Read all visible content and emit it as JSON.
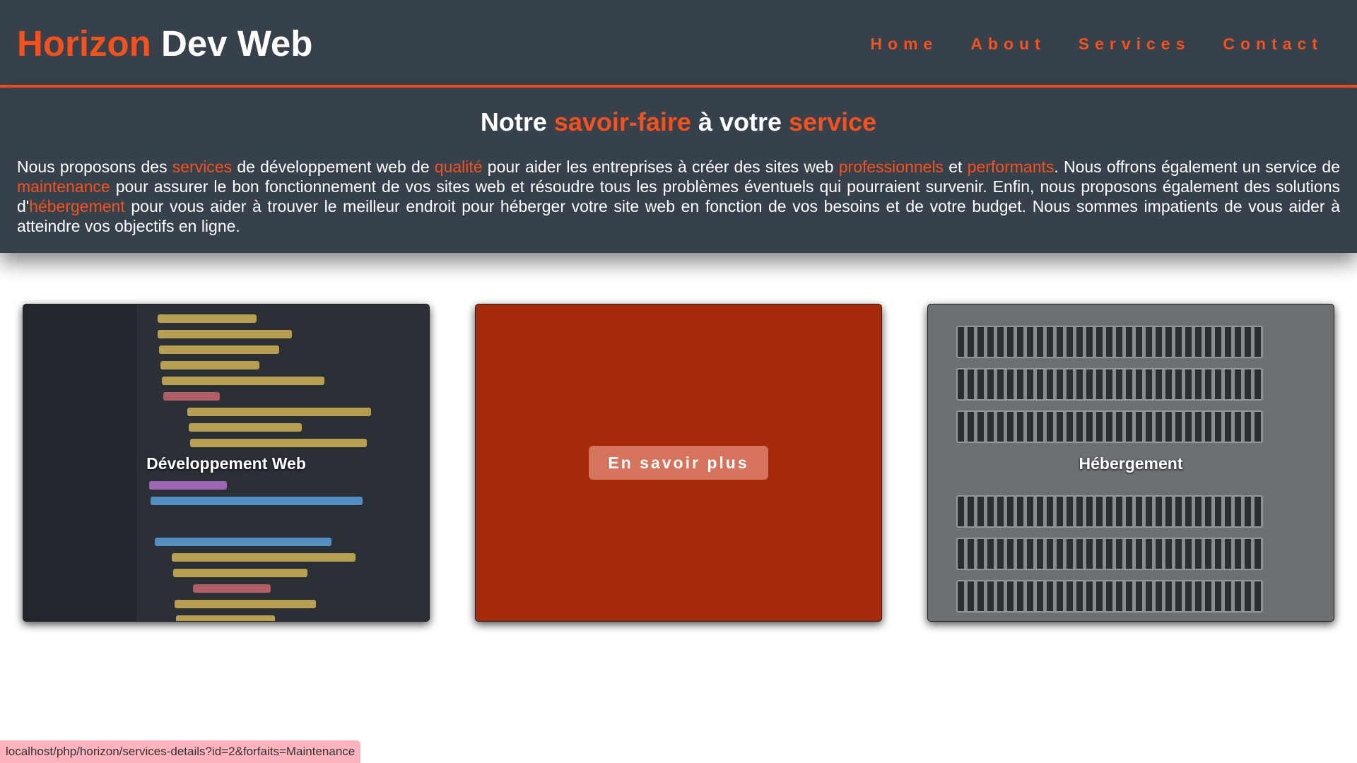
{
  "header": {
    "logo_part1": "Horizon",
    "logo_part2": " Dev Web",
    "nav": [
      "Home",
      "About",
      "Services",
      "Contact"
    ]
  },
  "intro": {
    "title_parts": [
      "Notre ",
      "savoir-faire",
      " à votre ",
      "service"
    ],
    "text_parts": [
      "Nous proposons des ",
      "services",
      " de développement web de ",
      "qualité",
      " pour aider les entreprises à créer des sites web ",
      "professionnels",
      " et ",
      "performants",
      ". Nous offrons également un service de ",
      "maintenance",
      " pour assurer le bon fonctionnement de vos sites web et résoudre tous les problèmes éventuels qui pourraient survenir. Enfin, nous proposons également des solutions d'",
      "hébergement",
      " pour vous aider à trouver le meilleur endroit pour héberger votre site web en fonction de vos besoins et de votre budget. Nous sommes impatients de vous aider à atteindre vos objectifs en ligne."
    ]
  },
  "cards": [
    {
      "label": "Développement Web"
    },
    {
      "button": "En savoir plus"
    },
    {
      "label": "Hébergement"
    }
  ],
  "status_bar": "localhost/php/horizon/services-details?id=2&forfaits=Maintenance",
  "colors": {
    "accent": "#f4511e",
    "header_bg": "#37414b",
    "active_card": "#a52a0c"
  }
}
